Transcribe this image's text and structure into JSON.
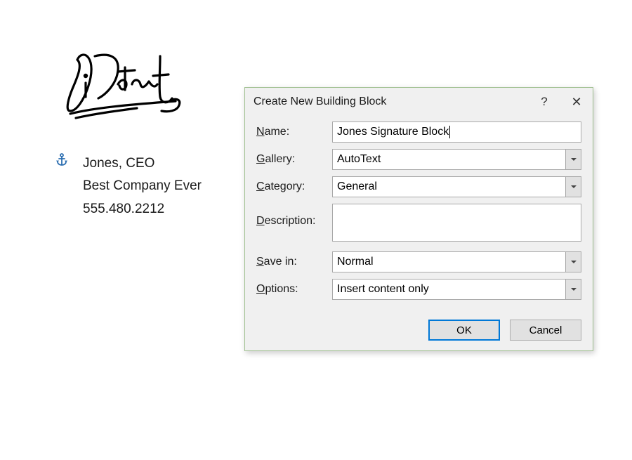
{
  "signature_block": {
    "line1": "Jones, CEO",
    "line2": "Best Company Ever",
    "line3": "555.480.2212"
  },
  "dialog": {
    "title": "Create New Building Block",
    "help_symbol": "?",
    "labels": {
      "name": "Name:",
      "gallery": "Gallery:",
      "category": "Category:",
      "description": "Description:",
      "save_in": "Save in:",
      "options": "Options:"
    },
    "values": {
      "name": "Jones Signature Block",
      "gallery": "AutoText",
      "category": "General",
      "description": "",
      "save_in": "Normal",
      "options": "Insert content only"
    },
    "buttons": {
      "ok": "OK",
      "cancel": "Cancel"
    }
  }
}
